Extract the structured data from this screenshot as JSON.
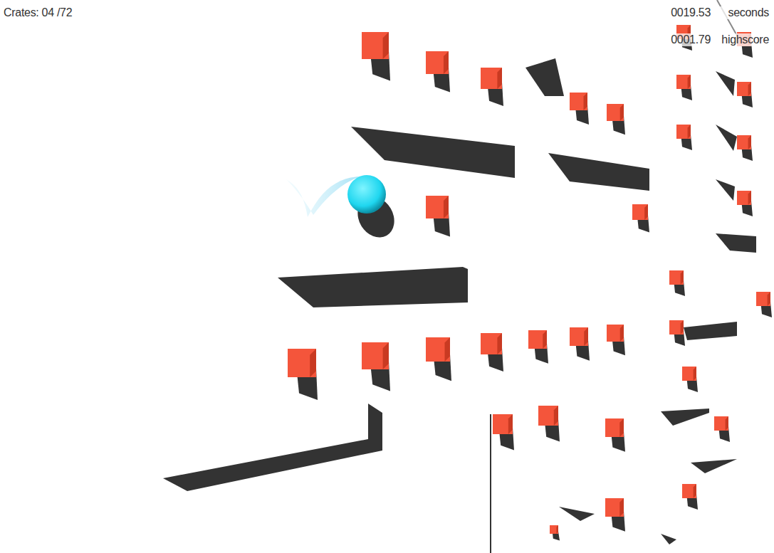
{
  "hud": {
    "crates": "Crates: 04 /72",
    "timer": {
      "value": "0019.53",
      "unit": "seconds"
    },
    "highscore": {
      "value": "0001.79",
      "unit": "highscore"
    }
  }
}
